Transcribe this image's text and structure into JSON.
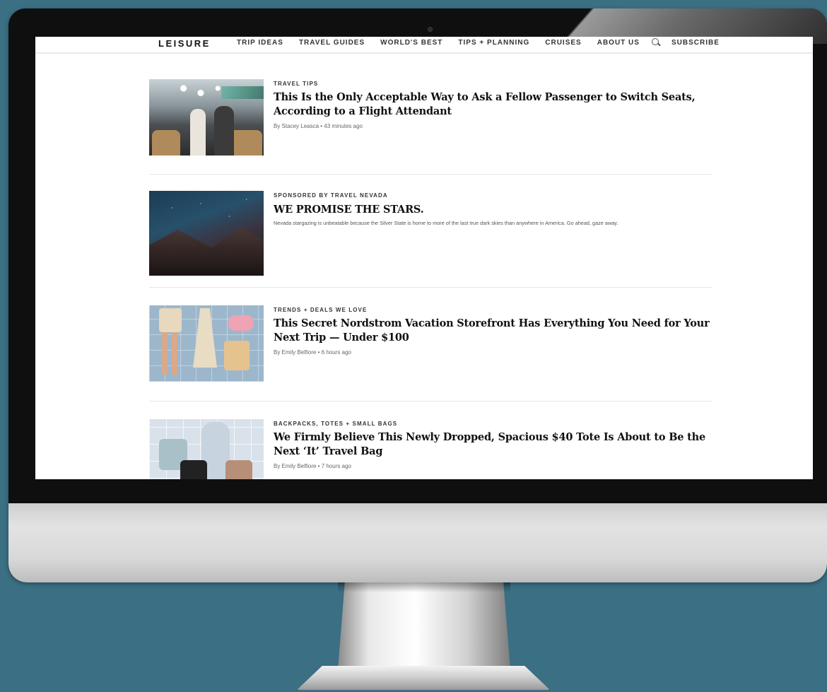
{
  "nav": {
    "logo": "LEISURE",
    "links": [
      "TRIP IDEAS",
      "TRAVEL GUIDES",
      "WORLD'S BEST",
      "TIPS + PLANNING",
      "CRUISES",
      "ABOUT US"
    ],
    "subscribe": "SUBSCRIBE"
  },
  "articles": [
    {
      "kicker": "TRAVEL TIPS",
      "headline": "This Is the Only Acceptable Way to Ask a Fellow Passenger to Switch Seats, According to a Flight Attendant",
      "byline": "By Stacey Leasca • 43 minutes ago"
    },
    {
      "kicker": "SPONSORED BY TRAVEL NEVADA",
      "headline": "WE PROMISE THE STARS.",
      "description": "Nevada stargazing is unbeatable because the Silver State is home to more of the last true dark skies than anywhere in America. Go ahead, gaze away."
    },
    {
      "kicker": "TRENDS + DEALS WE LOVE",
      "headline": "This Secret Nordstrom Vacation Storefront Has Everything You Need for Your Next Trip — Under $100",
      "byline": "By Emily Belfiore • 6 hours ago"
    },
    {
      "kicker": "BACKPACKS, TOTES + SMALL BAGS",
      "headline": "We Firmly Believe This Newly Dropped, Spacious $40 Tote Is About to Be the Next ‘It’ Travel Bag",
      "byline": "By Emily Belfiore • 7 hours ago"
    }
  ]
}
